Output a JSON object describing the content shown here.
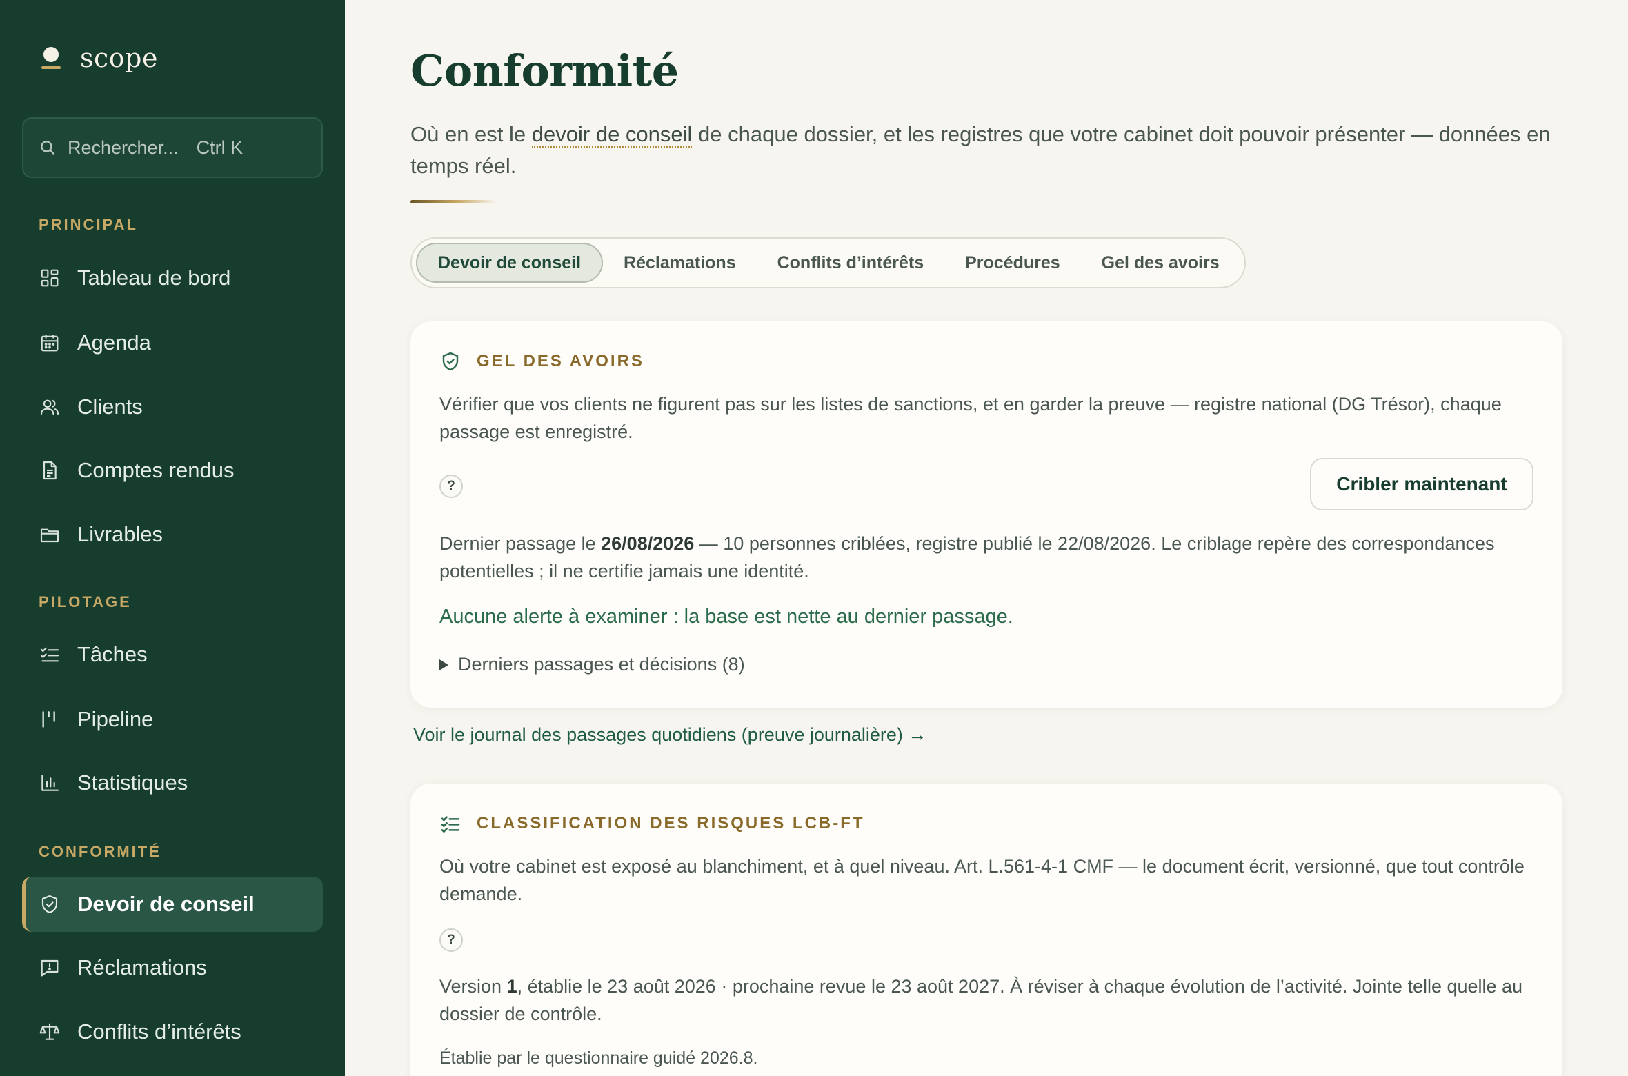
{
  "app": {
    "name": "scope"
  },
  "search": {
    "placeholder": "Rechercher...",
    "shortcut": "Ctrl K"
  },
  "sidebar": {
    "sections": [
      {
        "label": "PRINCIPAL",
        "items": [
          {
            "label": "Tableau de bord",
            "icon": "dashboard-icon"
          },
          {
            "label": "Agenda",
            "icon": "calendar-icon"
          },
          {
            "label": "Clients",
            "icon": "users-icon"
          },
          {
            "label": "Comptes rendus",
            "icon": "document-icon"
          },
          {
            "label": "Livrables",
            "icon": "folder-icon"
          }
        ]
      },
      {
        "label": "PILOTAGE",
        "items": [
          {
            "label": "Tâches",
            "icon": "checklist-icon"
          },
          {
            "label": "Pipeline",
            "icon": "pipeline-icon"
          },
          {
            "label": "Statistiques",
            "icon": "bar-chart-icon"
          }
        ]
      },
      {
        "label": "CONFORMITÉ",
        "items": [
          {
            "label": "Devoir de conseil",
            "icon": "shield-check-icon",
            "active": true
          },
          {
            "label": "Réclamations",
            "icon": "message-alert-icon"
          },
          {
            "label": "Conflits d’intérêts",
            "icon": "scale-icon"
          }
        ]
      }
    ]
  },
  "page": {
    "title": "Conformité",
    "description_before": "Où en est le ",
    "description_term": "devoir de conseil",
    "description_after": " de chaque dossier, et les registres que votre cabinet doit pouvoir présenter — données en temps réel."
  },
  "tabs": [
    {
      "label": "Devoir de conseil",
      "active": true
    },
    {
      "label": "Réclamations"
    },
    {
      "label": "Conflits d’intérêts"
    },
    {
      "label": "Procédures"
    },
    {
      "label": "Gel des avoirs"
    }
  ],
  "gel_card": {
    "title": "GEL DES AVOIRS",
    "icon": "shield-check-icon",
    "description": "Vérifier que vos clients ne figurent pas sur les listes de sanctions, et en garder la preuve — registre national (DG Trésor), chaque passage est enregistré.",
    "help": "?",
    "button": "Cribler maintenant",
    "last_run_prefix": "Dernier passage le ",
    "last_run_date": "26/08/2026",
    "last_run_suffix": " — 10 personnes criblées, registre publié le 22/08/2026. Le criblage repère des correspondances potentielles ; il ne certifie jamais une identité.",
    "status": "Aucune alerte à examiner : la base est nette au dernier passage.",
    "details": "Derniers passages et décisions (8)"
  },
  "journal_link": "Voir le journal des passages quotidiens (preuve journalière) →",
  "risk_card": {
    "title": "CLASSIFICATION DES RISQUES LCB-FT",
    "icon": "checklist-icon",
    "description": "Où votre cabinet est exposé au blanchiment, et à quel niveau. Art. L.561-4-1 CMF — le document écrit, versionné, que tout contrôle demande.",
    "help": "?",
    "version_prefix": "Version ",
    "version_number": "1",
    "version_suffix": ", établie le 23 août 2026 · prochaine revue le 23 août 2027. À réviser à chaque évolution de l’activité. Jointe telle quelle au dossier de contrôle.",
    "established_by": "Établie par le questionnaire guidé 2026.8."
  },
  "colors": {
    "sidebar_bg": "#173d2f",
    "accent_gold": "#c8a865",
    "page_bg": "#f7f5ef",
    "link_green": "#1f5c43"
  }
}
